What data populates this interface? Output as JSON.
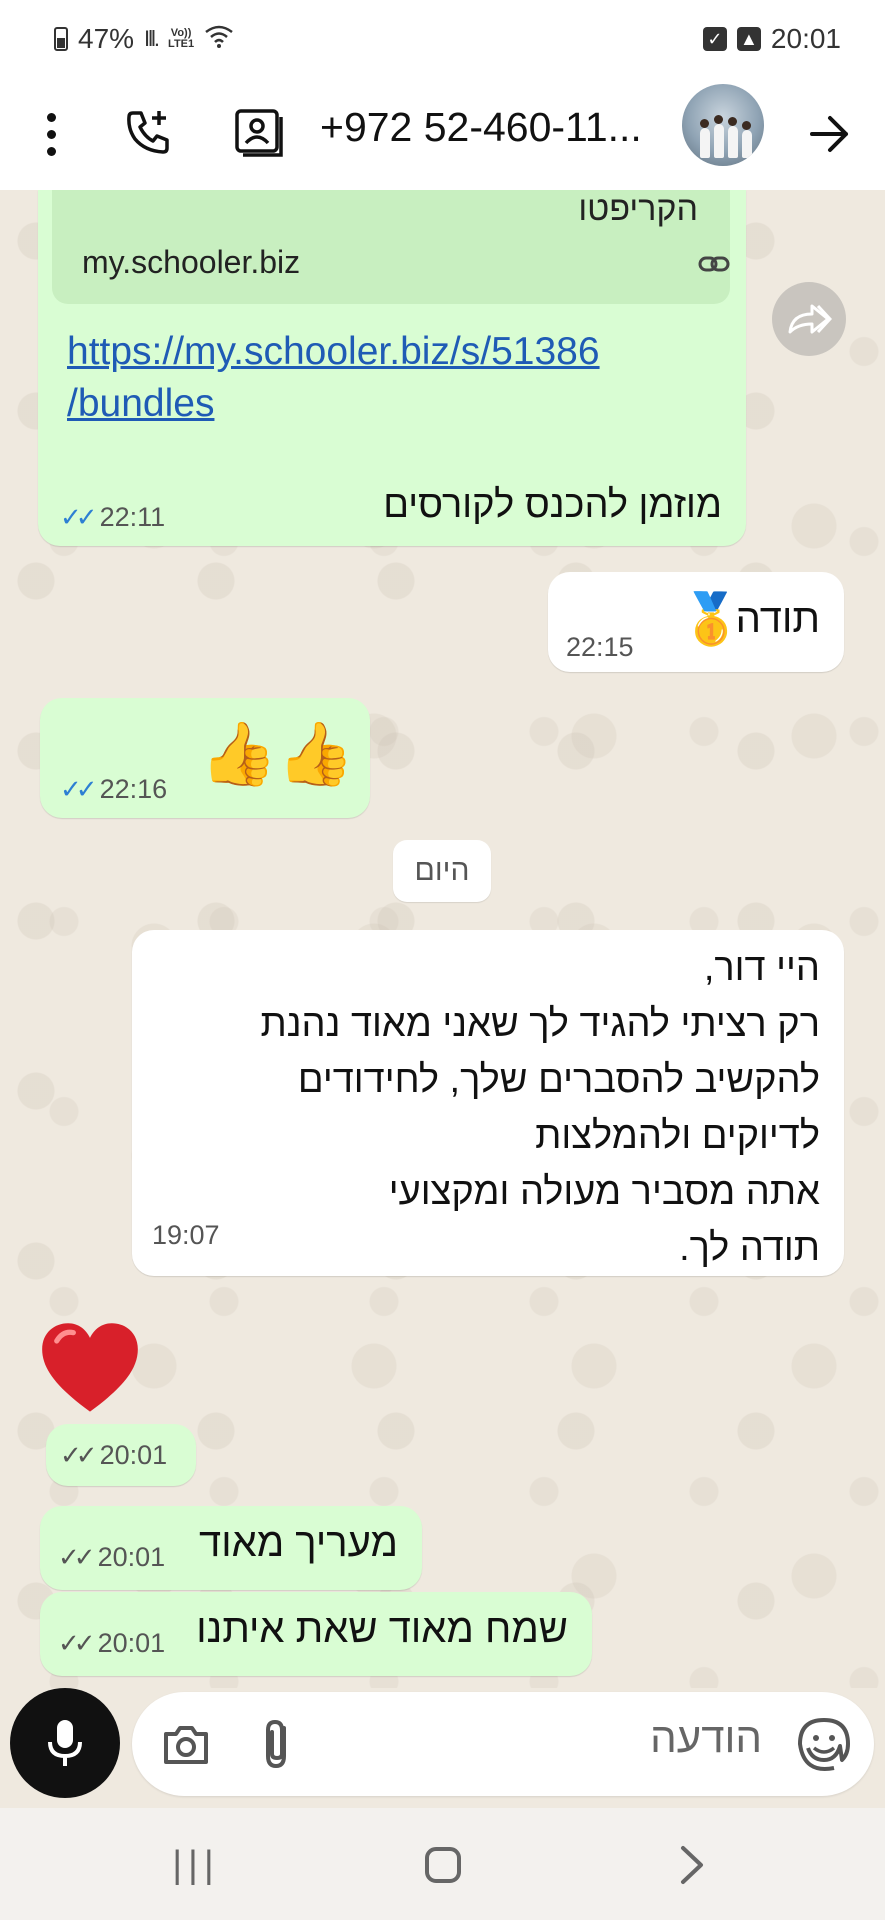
{
  "status_bar": {
    "battery": "47%",
    "volte_line1": "Vo))",
    "volte_line2": "LTE1",
    "time": "20:01"
  },
  "header": {
    "contact_name": "+972 52-460-11..."
  },
  "messages": {
    "link_message": {
      "preview_title": "הקריפטו",
      "preview_domain": "my.schooler.biz",
      "link": "https://my.schooler.biz/s/51386 /bundles",
      "text": "מוזמן להכנס לקורסים",
      "time": "22:11"
    },
    "thanks": {
      "text": "תודה",
      "emoji": "🥇",
      "time": "22:15"
    },
    "thumbs": {
      "emoji": "👍👍",
      "time": "22:16"
    },
    "date_divider": "היום",
    "long_message": {
      "text": "היי דור,\nרק רציתי להגיד לך שאני מאוד נהנת\nלהקשיב להסברים שלך, לחידודים\nלדיוקים ולהמלצות\nאתה מסביר מעולה ומקצועי\nתודה לך.",
      "time": "19:07"
    },
    "heart_time": "20:01",
    "appreciate": {
      "text": "מעריך מאוד",
      "time": "20:01"
    },
    "happy": {
      "text": "שמח מאוד שאת איתנו",
      "time": "20:01"
    }
  },
  "input": {
    "placeholder": "הודעה"
  },
  "colors": {
    "outgoing_bubble": "#d9fdd3",
    "incoming_bubble": "#ffffff",
    "chat_background": "#efe9df",
    "read_ticks": "#2d7fd3",
    "link": "#1f5bb5"
  }
}
